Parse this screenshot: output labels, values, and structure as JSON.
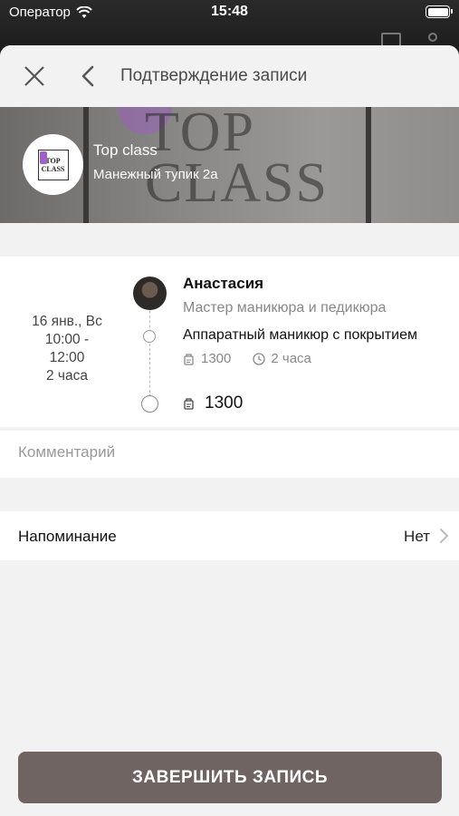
{
  "status_bar": {
    "carrier": "Оператор",
    "time": "15:48"
  },
  "nav": {
    "title": "Подтверждение записи"
  },
  "salon": {
    "name": "Top class",
    "address": "Манежный тупик 2а",
    "logo_text_line1": "TOP",
    "logo_text_line2": "CLASS",
    "banner_text": "TOP CLASS"
  },
  "appointment": {
    "date": "16 янв., Вс",
    "time_start": "10:00 -",
    "time_end": "12:00",
    "duration": "2 часа",
    "master_name": "Анастасия",
    "master_role": "Мастер маникюра и педикюра",
    "service_name": "Аппаратный маникюр с покрытием",
    "service_price": "1300",
    "service_duration": "2 часа",
    "total_price": "1300"
  },
  "comment": {
    "placeholder": "Комментарий"
  },
  "reminder": {
    "label": "Напоминание",
    "value": "Нет"
  },
  "submit": {
    "label": "ЗАВЕРШИТЬ ЗАПИСЬ"
  },
  "colors": {
    "accent_button": "#6f6462",
    "sheet_bg": "#f2f2f2"
  }
}
